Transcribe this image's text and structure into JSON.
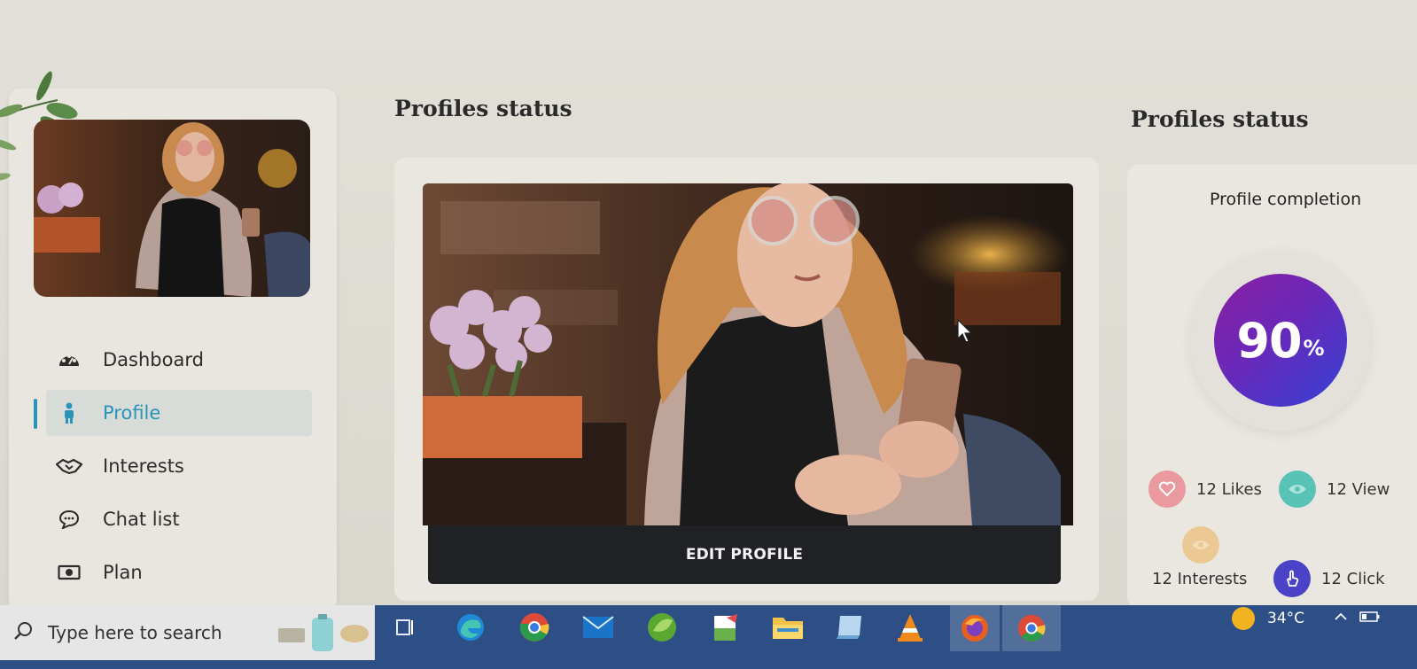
{
  "sidebar": {
    "items": [
      {
        "label": "Dashboard",
        "icon": "dashboard-icon",
        "active": false
      },
      {
        "label": "Profile",
        "icon": "person-icon",
        "active": true
      },
      {
        "label": "Interests",
        "icon": "handshake-icon",
        "active": false
      },
      {
        "label": "Chat list",
        "icon": "chat-icon",
        "active": false
      },
      {
        "label": "Plan",
        "icon": "money-icon",
        "active": false
      }
    ]
  },
  "main": {
    "heading": "Profiles status",
    "edit_button": "EDIT PROFILE"
  },
  "status_panel": {
    "heading": "Profiles status",
    "completion_title": "Profile completion",
    "completion_value": "90",
    "completion_unit": "%",
    "completion_fraction": 0.9,
    "stats": {
      "likes": "12 Likes",
      "views": "12 View",
      "interests": "12 Interests",
      "clicks": "12 Click"
    }
  },
  "taskbar": {
    "search_placeholder": "Type here to search",
    "temperature": "34°C",
    "apps": [
      "task-view",
      "edge",
      "chrome",
      "mail",
      "app-green",
      "notepad",
      "file-explorer",
      "app-blue",
      "vlc",
      "firefox",
      "chrome-active"
    ]
  },
  "colors": {
    "accent": "#2a93b8",
    "completion_start": "#8a1fa3",
    "completion_end": "#3341d6",
    "taskbar": "#2d4f86"
  }
}
